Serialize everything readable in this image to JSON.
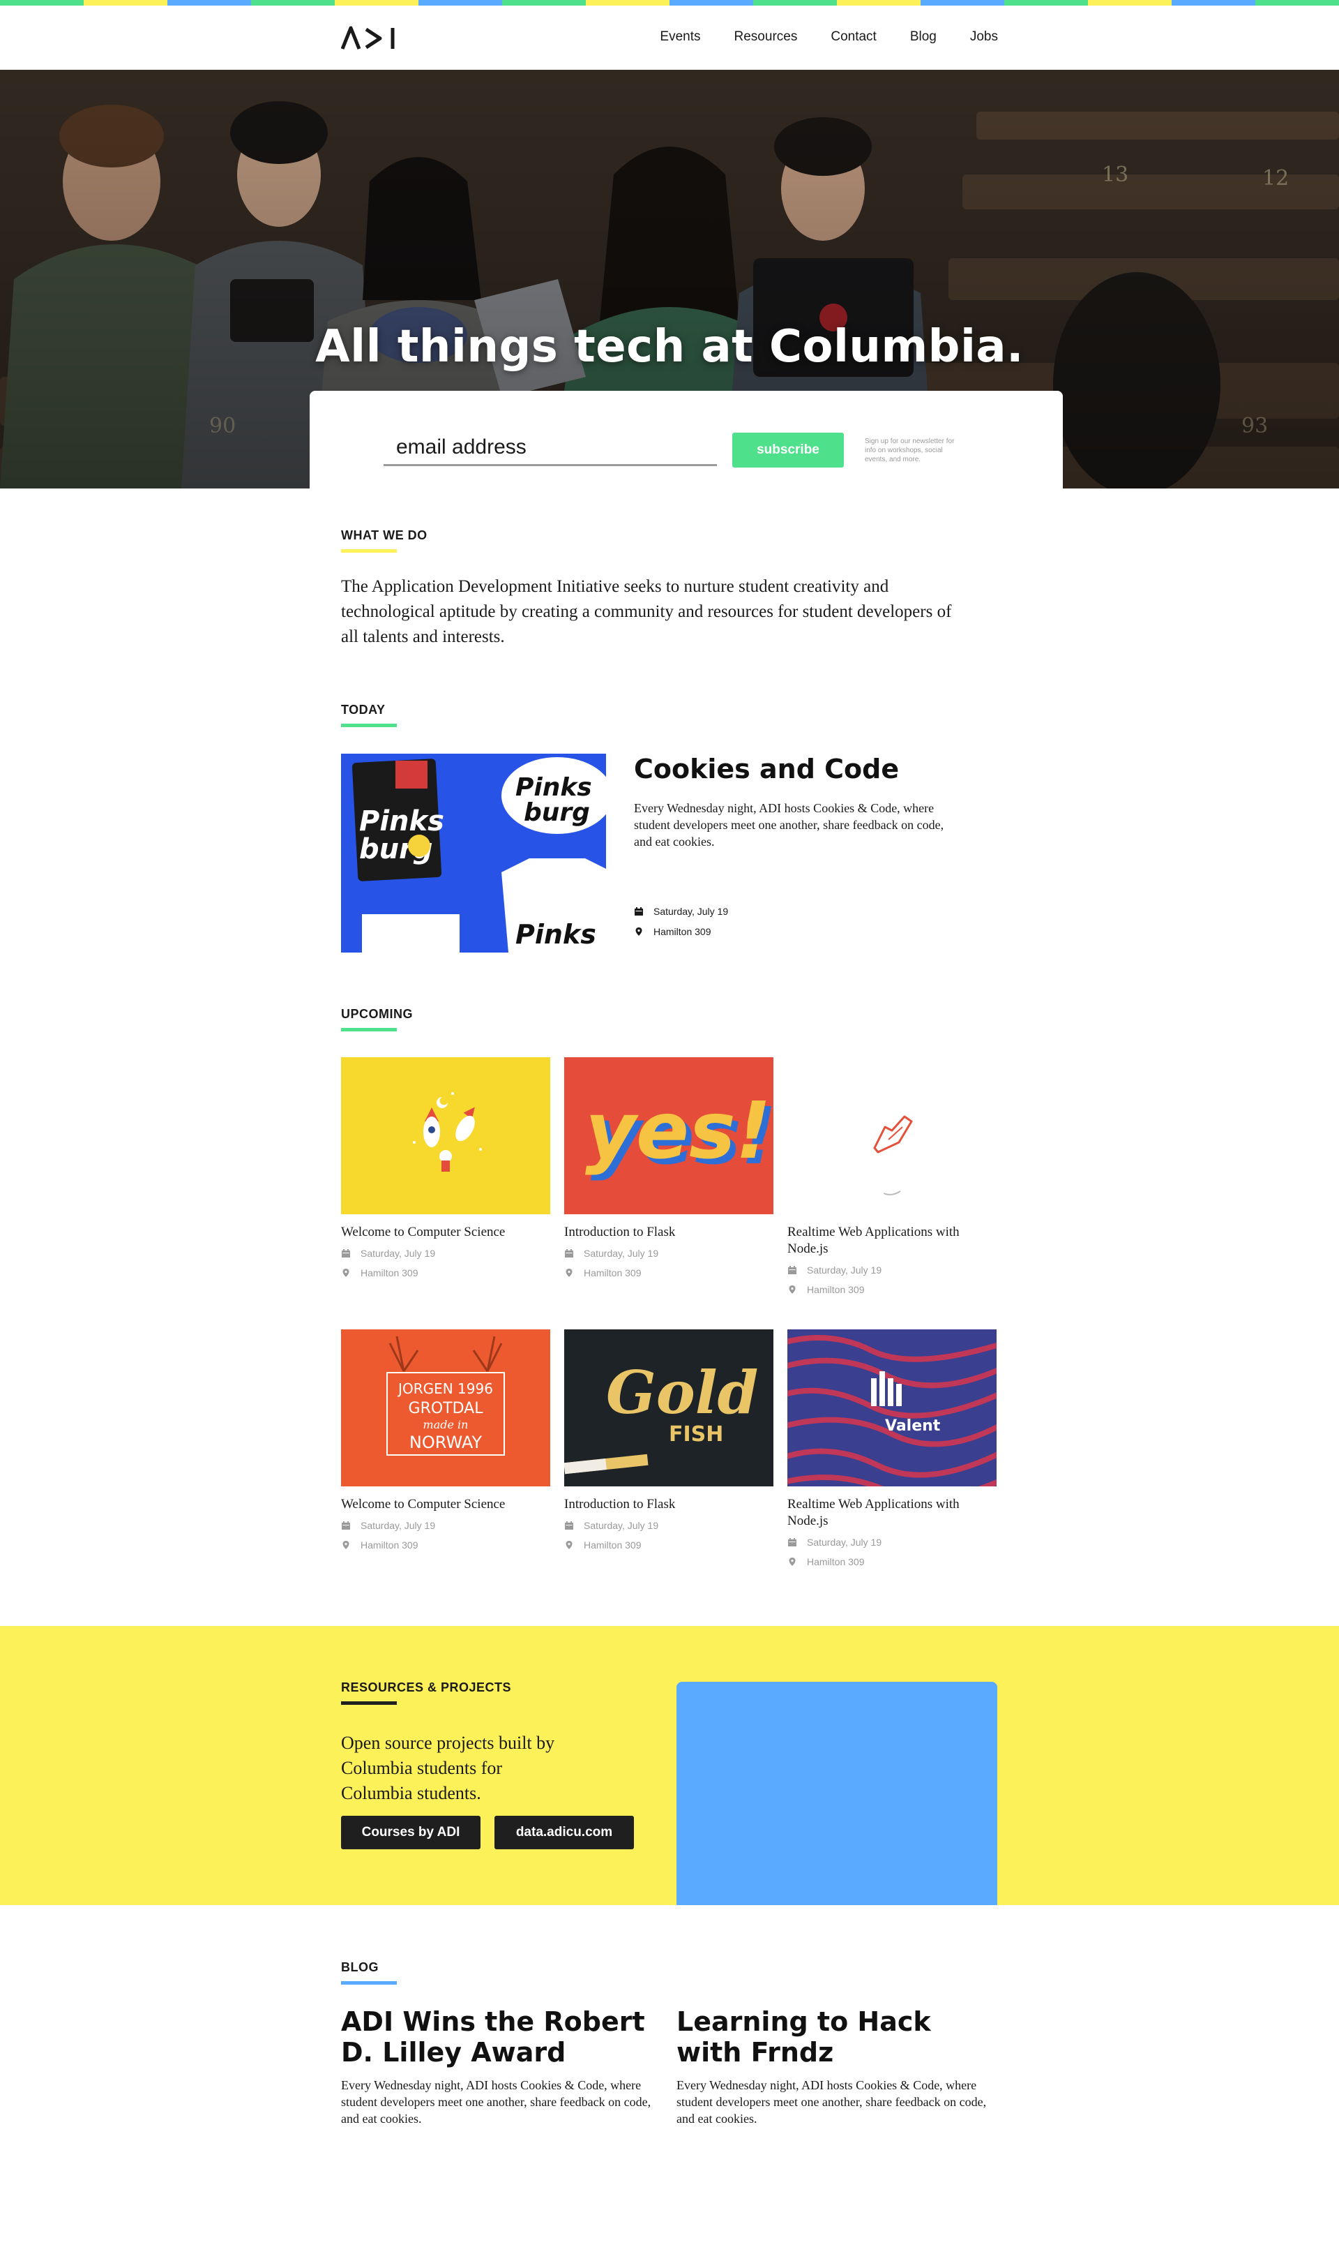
{
  "colors": {
    "green": "#4fe08c",
    "yellow": "#fdf15a",
    "blue": "#5aaaff",
    "dark": "#1f1f1f",
    "grey": "#9a9a9a"
  },
  "stripe_colors": [
    "#4fe08c",
    "#fdf15a",
    "#5aaaff",
    "#4fe08c",
    "#fdf15a",
    "#5aaaff",
    "#4fe08c",
    "#fdf15a",
    "#5aaaff",
    "#4fe08c",
    "#fdf15a",
    "#5aaaff",
    "#4fe08c",
    "#fdf15a",
    "#5aaaff",
    "#4fe08c"
  ],
  "header": {
    "logo_text": "ADI",
    "nav": [
      "Events",
      "Resources",
      "Contact",
      "Blog",
      "Jobs"
    ]
  },
  "hero": {
    "title": "All things tech at Columbia.",
    "email_placeholder": "email address",
    "subscribe_label": "subscribe",
    "signup_note": "Sign up for our newsletter for info on workshops, social events, and more."
  },
  "what_we_do": {
    "label": "WHAT WE DO",
    "text": "The Application Development Initiative seeks to nurture student creativity and technological aptitude by creating a community and resources for student developers of all talents and interests."
  },
  "today": {
    "label": "TODAY",
    "title": "Cookies and Code",
    "description": "Every Wednesday night, ADI hosts Cookies & Code, where student developers meet one another, share feedback on code, and eat cookies.",
    "date": "Saturday, July 19",
    "location": "Hamilton 309",
    "image_icon": "pinkburg-image"
  },
  "upcoming": {
    "label": "UPCOMING",
    "events": [
      {
        "title": "Welcome to Computer Science",
        "date": "Saturday, July 19",
        "location": "Hamilton 309",
        "image_icon": "rocket-illustration"
      },
      {
        "title": "Introduction to Flask",
        "date": "Saturday, July 19",
        "location": "Hamilton 309",
        "image_icon": "yes-lettering"
      },
      {
        "title": "Realtime Web Applications with Node.js",
        "date": "Saturday, July 19",
        "location": "Hamilton 309",
        "image_icon": "sneaker-illustration"
      },
      {
        "title": "Welcome to Computer Science",
        "date": "Saturday, July 19",
        "location": "Hamilton 309",
        "image_icon": "jorgen-deer-poster"
      },
      {
        "title": "Introduction to Flask",
        "date": "Saturday, July 19",
        "location": "Hamilton 309",
        "image_icon": "gold-fish-lettering"
      },
      {
        "title": "Realtime Web Applications with Node.js",
        "date": "Saturday, July 19",
        "location": "Hamilton 309",
        "image_icon": "valent-poster"
      }
    ]
  },
  "resources": {
    "label": "RESOURCES & PROJECTS",
    "text": "Open source projects built by Columbia students for Columbia students.",
    "buttons": [
      "Courses by ADI",
      "data.adicu.com"
    ]
  },
  "blog": {
    "label": "BLOG",
    "posts": [
      {
        "title": "ADI Wins the Robert D. Lilley Award",
        "description": "Every Wednesday night, ADI hosts Cookies & Code, where student developers meet one another, share feedback on code, and eat cookies."
      },
      {
        "title": "Learning to Hack with Frndz",
        "description": "Every Wednesday night, ADI hosts Cookies & Code, where student developers meet one another, share feedback on code, and eat cookies."
      }
    ]
  },
  "image_text": {
    "yes": "yes!",
    "gold": "Gold",
    "fish": "FISH",
    "valent": "Valent",
    "jorgen_1": "JORGEN 1996",
    "jorgen_2": "GROTDAL",
    "jorgen_3": "made in",
    "jorgen_4": "NORWAY",
    "pinks": "Pinks",
    "burg": "burg"
  }
}
